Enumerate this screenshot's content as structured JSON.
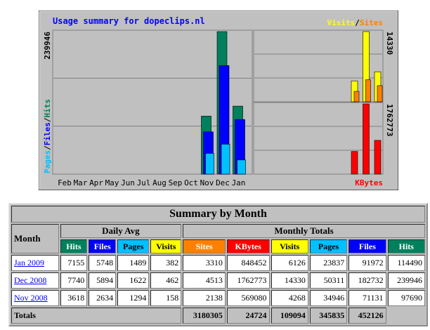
{
  "chart_data": {
    "type": "bar",
    "title": "Usage summary for dopeclips.nl",
    "months": [
      "Feb",
      "Mar",
      "Apr",
      "May",
      "Jun",
      "Jul",
      "Aug",
      "Sep",
      "Oct",
      "Nov",
      "Dec",
      "Jan"
    ],
    "left_chart": {
      "axis_max_label": "239946",
      "ymax": 239946,
      "legend": [
        "Pages",
        "Files",
        "Hits"
      ],
      "series": [
        {
          "name": "Hits",
          "color": "#00805c",
          "values": [
            0,
            0,
            0,
            0,
            0,
            0,
            0,
            0,
            0,
            97690,
            239946,
            114490
          ]
        },
        {
          "name": "Files",
          "color": "#0000ff",
          "values": [
            0,
            0,
            0,
            0,
            0,
            0,
            0,
            0,
            0,
            71131,
            182732,
            91972
          ]
        },
        {
          "name": "Pages",
          "color": "#00c0ff",
          "values": [
            0,
            0,
            0,
            0,
            0,
            0,
            0,
            0,
            0,
            34946,
            50311,
            23837
          ]
        }
      ]
    },
    "right_top_chart": {
      "axis_max_label": "14330",
      "ymax": 14330,
      "legend": [
        "Visits",
        "Sites"
      ],
      "legend_sep": "/",
      "categories": [
        "Nov 2008",
        "Dec 2008",
        "Jan 2009"
      ],
      "series": [
        {
          "name": "Visits",
          "color": "#ffff00",
          "values": [
            4268,
            14330,
            6126
          ]
        },
        {
          "name": "Sites",
          "color": "#ff8000",
          "values": [
            2138,
            4513,
            3310
          ]
        }
      ]
    },
    "right_bottom_chart": {
      "axis_max_label": "1762773",
      "ymax": 1762773,
      "legend": [
        "KBytes"
      ],
      "categories": [
        "Nov 2008",
        "Dec 2008",
        "Jan 2009"
      ],
      "series": [
        {
          "name": "KBytes",
          "color": "#ff0000",
          "values": [
            569080,
            1762773,
            848452
          ]
        }
      ]
    }
  },
  "summary": {
    "title": "Summary by Month",
    "month_header": "Month",
    "daily_avg_header": "Daily Avg",
    "monthly_totals_header": "Monthly Totals",
    "columns": {
      "d_hits": "Hits",
      "d_files": "Files",
      "d_pages": "Pages",
      "d_visits": "Visits",
      "m_sites": "Sites",
      "m_kbytes": "KBytes",
      "m_visits": "Visits",
      "m_pages": "Pages",
      "m_files": "Files",
      "m_hits": "Hits"
    },
    "column_colors": {
      "hits": "#00805c",
      "files": "#0000ff",
      "pages": "#00c0ff",
      "visits": "#ffff00",
      "sites": "#ff8000",
      "kbytes": "#ff0000"
    },
    "rows": [
      {
        "month": "Jan 2009",
        "d_hits": "7155",
        "d_files": "5748",
        "d_pages": "1489",
        "d_visits": "382",
        "m_sites": "3310",
        "m_kbytes": "848452",
        "m_visits": "6126",
        "m_pages": "23837",
        "m_files": "91972",
        "m_hits": "114490"
      },
      {
        "month": "Dec 2008",
        "d_hits": "7740",
        "d_files": "5894",
        "d_pages": "1622",
        "d_visits": "462",
        "m_sites": "4513",
        "m_kbytes": "1762773",
        "m_visits": "14330",
        "m_pages": "50311",
        "m_files": "182732",
        "m_hits": "239946"
      },
      {
        "month": "Nov 2008",
        "d_hits": "3618",
        "d_files": "2634",
        "d_pages": "1294",
        "d_visits": "158",
        "m_sites": "2138",
        "m_kbytes": "569080",
        "m_visits": "4268",
        "m_pages": "34946",
        "m_files": "71131",
        "m_hits": "97690"
      }
    ],
    "totals": {
      "label": "Totals",
      "m_kbytes": "3180305",
      "m_visits": "24724",
      "m_pages": "109094",
      "m_files": "345835",
      "m_hits": "452126"
    }
  }
}
